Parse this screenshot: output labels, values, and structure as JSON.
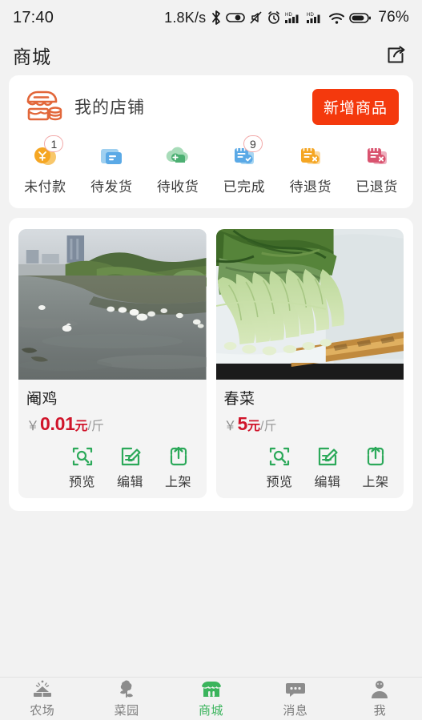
{
  "statusbar": {
    "time": "17:40",
    "net_speed": "1.8K/s",
    "bluetooth_icon": "bluetooth-icon",
    "data_saver_icon": "data-saver-icon",
    "mute_icon": "mute-icon",
    "alarm_icon": "alarm-icon",
    "hd_icon_1": "hd-signal-icon",
    "hd_icon_2": "hd-signal-icon",
    "wifi_icon": "wifi-icon",
    "battery_icon": "battery-icon",
    "battery_pct": "76%"
  },
  "header": {
    "title": "商城",
    "share_icon": "share-icon"
  },
  "shop": {
    "icon": "storefront-icon",
    "name": "我的店铺",
    "add_product_label": "新增商品",
    "accent": "#f4390d"
  },
  "order_tabs": [
    {
      "label": "未付款",
      "icon": "coin-yuan-icon",
      "badge": "1",
      "color": "#f5a623"
    },
    {
      "label": "待发货",
      "icon": "shipping-box-icon",
      "badge": "",
      "color": "#5aa9e6"
    },
    {
      "label": "待收货",
      "icon": "delivery-truck-icon",
      "badge": "",
      "color": "#4caf72"
    },
    {
      "label": "已完成",
      "icon": "document-check-icon",
      "badge": "9",
      "color": "#5aa9e6"
    },
    {
      "label": "待退货",
      "icon": "document-return-icon",
      "badge": "",
      "color": "#f5a623"
    },
    {
      "label": "已退货",
      "icon": "document-returned-icon",
      "badge": "",
      "color": "#d9536f"
    }
  ],
  "products": [
    {
      "name": "阉鸡",
      "currency": "￥",
      "price": "0.01",
      "unit": "元",
      "per": "/斤",
      "image_alt": "river-with-ducks-photo",
      "actions": [
        {
          "label": "预览",
          "icon": "preview-magnifier-icon"
        },
        {
          "label": "编辑",
          "icon": "edit-pencil-icon"
        },
        {
          "label": "上架",
          "icon": "publish-upload-icon"
        }
      ]
    },
    {
      "name": "春菜",
      "currency": "￥",
      "price": "5",
      "unit": "元",
      "per": "/斤",
      "image_alt": "green-leafy-vegetables-photo",
      "actions": [
        {
          "label": "预览",
          "icon": "preview-magnifier-icon"
        },
        {
          "label": "编辑",
          "icon": "edit-pencil-icon"
        },
        {
          "label": "上架",
          "icon": "publish-upload-icon"
        }
      ]
    }
  ],
  "bottom_nav": {
    "active_color": "#3bb45c",
    "items": [
      {
        "label": "农场",
        "icon": "farm-field-icon",
        "active": false
      },
      {
        "label": "菜园",
        "icon": "vegetable-garden-icon",
        "active": false
      },
      {
        "label": "商城",
        "icon": "store-icon",
        "active": true
      },
      {
        "label": "消息",
        "icon": "message-bubble-icon",
        "active": false
      },
      {
        "label": "我",
        "icon": "user-profile-icon",
        "active": false
      }
    ]
  }
}
